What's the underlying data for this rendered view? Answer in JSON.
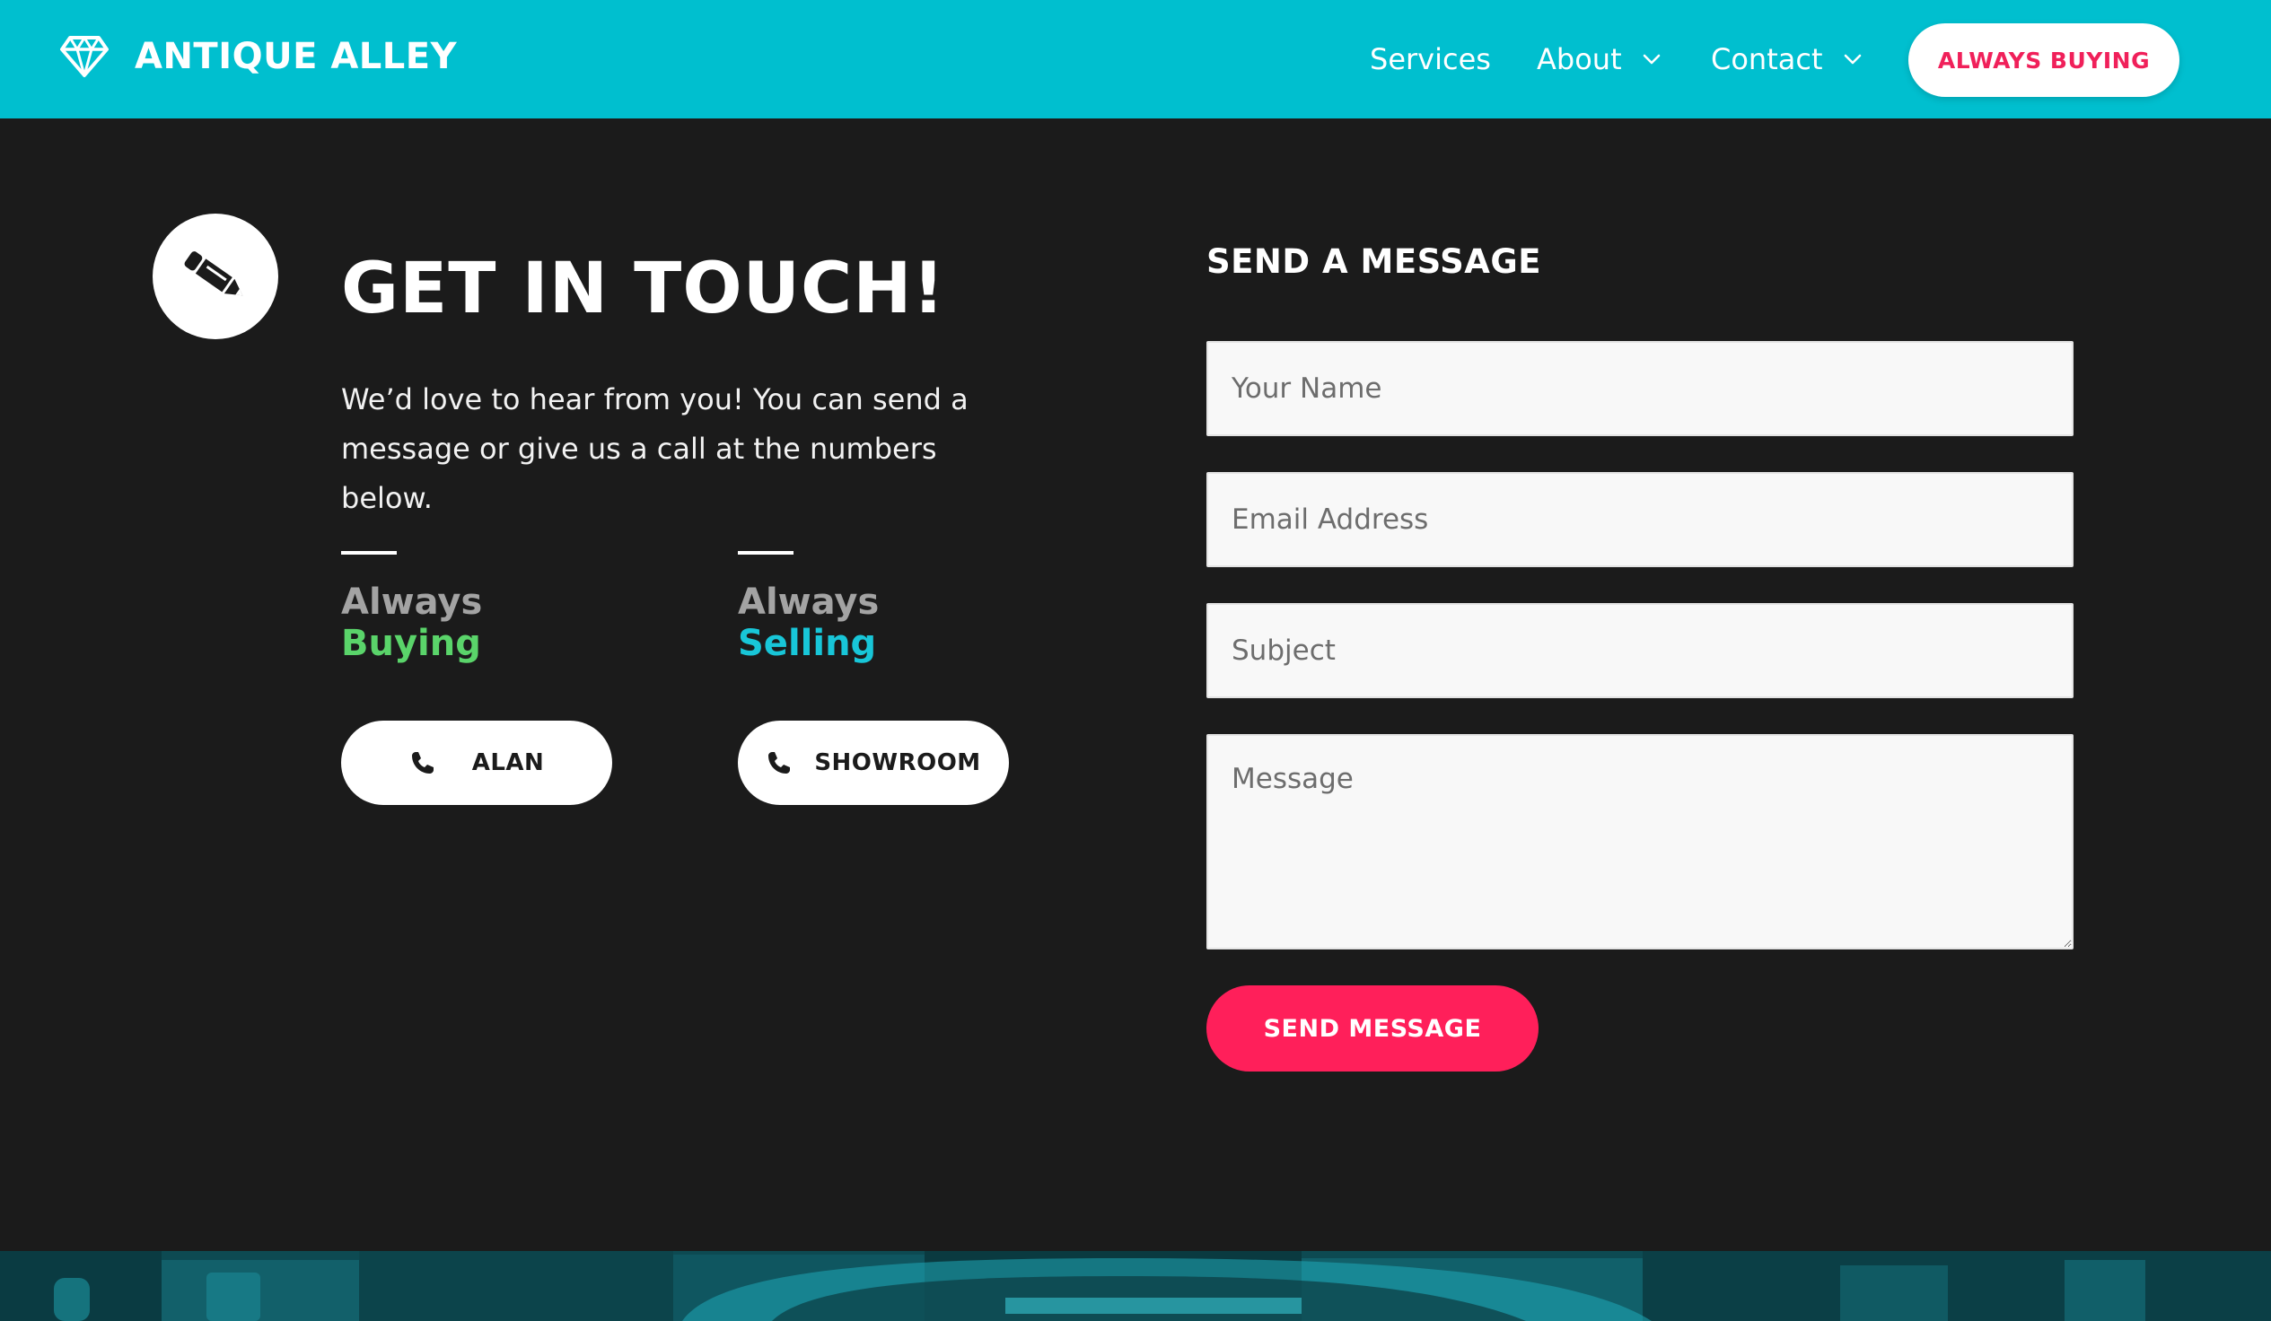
{
  "header": {
    "brand": "ANTIQUE ALLEY",
    "logo_icon": "diamond-icon",
    "nav": [
      {
        "label": "Services",
        "has_dropdown": false
      },
      {
        "label": "About",
        "has_dropdown": true
      },
      {
        "label": "Contact",
        "has_dropdown": true
      }
    ],
    "cta_label": "ALWAYS BUYING"
  },
  "contact": {
    "icon": "pencil-icon",
    "title": "GET IN TOUCH!",
    "intro": "We’d love to hear from you! You can send a message or give us a call at the numbers below.",
    "columns": [
      {
        "line1": "Always",
        "line2": "Buying",
        "button_label": "ALAN",
        "button_icon": "phone-icon"
      },
      {
        "line1": "Always",
        "line2": "Selling",
        "button_label": "SHOWROOM",
        "button_icon": "phone-icon"
      }
    ]
  },
  "form": {
    "title": "SEND A MESSAGE",
    "fields": {
      "name": {
        "placeholder": "Your Name",
        "value": ""
      },
      "email": {
        "placeholder": "Email Address",
        "value": ""
      },
      "subject": {
        "placeholder": "Subject",
        "value": ""
      },
      "message": {
        "placeholder": "Message",
        "value": ""
      }
    },
    "submit_label": "SEND MESSAGE"
  },
  "colors": {
    "header_bg": "#00bfcf",
    "page_bg": "#1b1b1b",
    "accent_pink": "#ff1f5a",
    "buying_green": "#5ad46a",
    "selling_teal": "#18c6d8"
  }
}
